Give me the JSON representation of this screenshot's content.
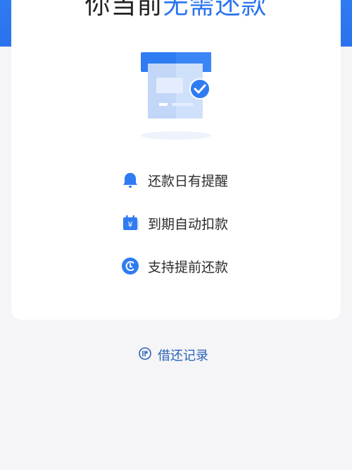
{
  "header": {
    "title_prefix": "你当前",
    "title_highlight": "无需还款"
  },
  "features": [
    {
      "label": "还款日有提醒",
      "icon": "bell-icon"
    },
    {
      "label": "到期自动扣款",
      "icon": "calendar-yen-icon"
    },
    {
      "label": "支持提前还款",
      "icon": "clock-circle-icon"
    }
  ],
  "footer": {
    "records_label": "借还记录",
    "records_icon": "record-icon"
  },
  "colors": {
    "accent": "#2a74ee",
    "title_text": "#222222",
    "link": "#2a62b8"
  }
}
